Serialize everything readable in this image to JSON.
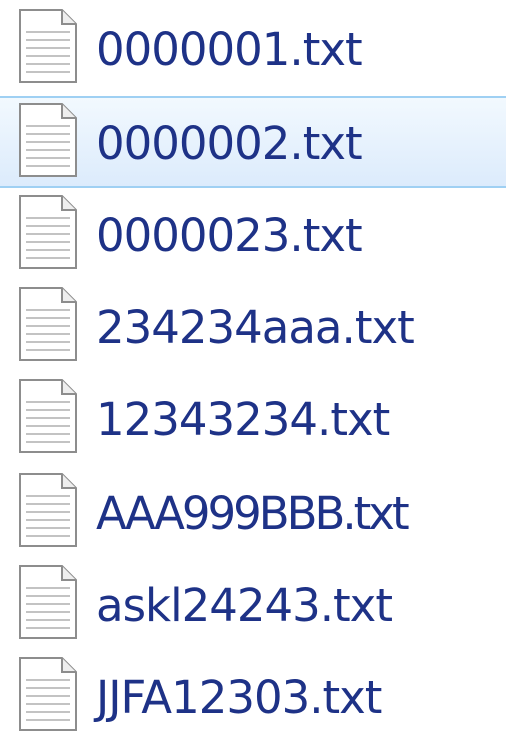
{
  "file_list": {
    "icon": "text-document-icon",
    "colors": {
      "text": "#1e3287",
      "selection_border": "#9fd0f3",
      "selection_fill": "#dcebfc"
    },
    "items": [
      {
        "name": "0000001.txt",
        "selected": false
      },
      {
        "name": "0000002.txt",
        "selected": true
      },
      {
        "name": "0000023.txt",
        "selected": false
      },
      {
        "name": "234234aaa.txt",
        "selected": false
      },
      {
        "name": "12343234.txt",
        "selected": false
      },
      {
        "name": "AAA999BBB.txt",
        "selected": false
      },
      {
        "name": "askl24243.txt",
        "selected": false
      },
      {
        "name": "JJFA12303.txt",
        "selected": false
      }
    ]
  }
}
